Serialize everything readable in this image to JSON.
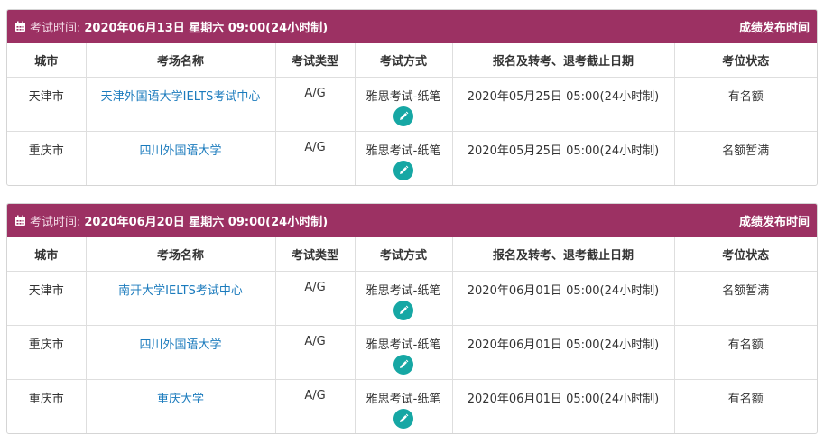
{
  "colors": {
    "header_bg": "#9c3163",
    "link": "#1b7bbd",
    "edit_button": "#16a7a4"
  },
  "columns": [
    "城市",
    "考场名称",
    "考试类型",
    "考试方式",
    "报名及转考、退考截止日期",
    "考位状态"
  ],
  "sessions": [
    {
      "label": "考试时间:",
      "date": "2020年06月13日 星期六 09:00(24小时制)",
      "score_link": "成绩发布时间",
      "rows": [
        {
          "city": "天津市",
          "venue": "天津外国语大学IELTS考试中心",
          "type": "A/G",
          "method": "雅思考试-纸笔",
          "deadline": "2020年05月25日 05:00(24小时制)",
          "status": "有名额"
        },
        {
          "city": "重庆市",
          "venue": "四川外国语大学",
          "type": "A/G",
          "method": "雅思考试-纸笔",
          "deadline": "2020年05月25日 05:00(24小时制)",
          "status": "名额暂满"
        }
      ]
    },
    {
      "label": "考试时间:",
      "date": "2020年06月20日 星期六 09:00(24小时制)",
      "score_link": "成绩发布时间",
      "rows": [
        {
          "city": "天津市",
          "venue": "南开大学IELTS考试中心",
          "type": "A/G",
          "method": "雅思考试-纸笔",
          "deadline": "2020年06月01日 05:00(24小时制)",
          "status": "名额暂满"
        },
        {
          "city": "重庆市",
          "venue": "四川外国语大学",
          "type": "A/G",
          "method": "雅思考试-纸笔",
          "deadline": "2020年06月01日 05:00(24小时制)",
          "status": "有名额"
        },
        {
          "city": "重庆市",
          "venue": "重庆大学",
          "type": "A/G",
          "method": "雅思考试-纸笔",
          "deadline": "2020年06月01日 05:00(24小时制)",
          "status": "有名额"
        }
      ]
    }
  ]
}
